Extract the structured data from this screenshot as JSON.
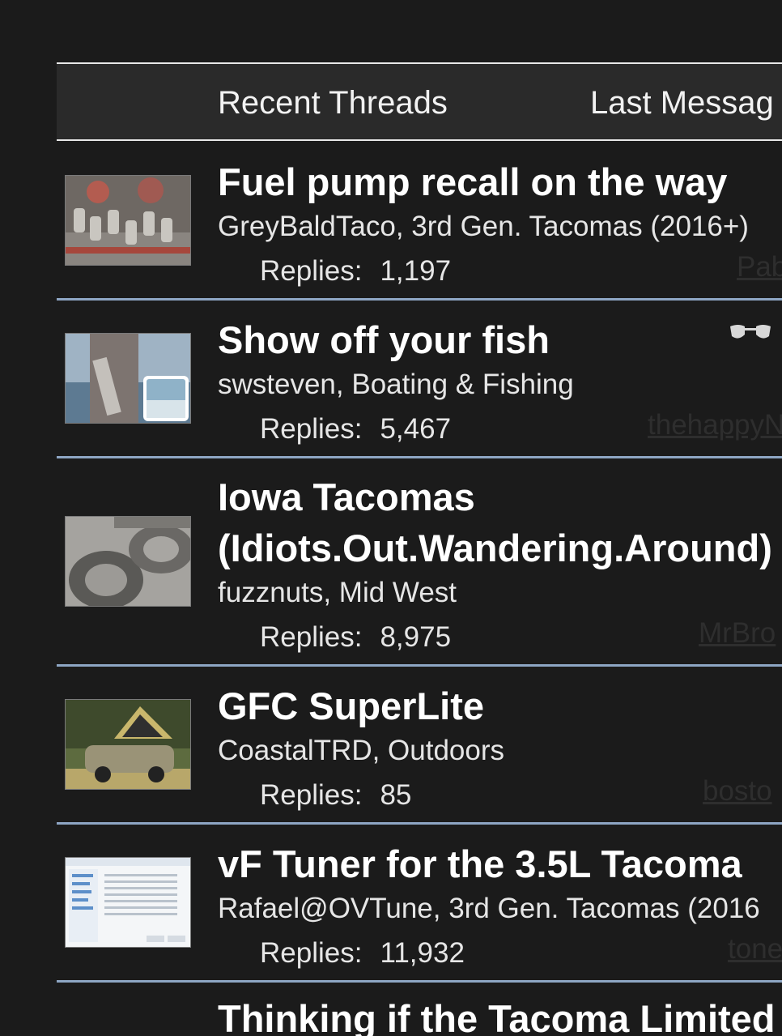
{
  "header": {
    "col_title": "Recent Threads",
    "col_last": "Last Messag"
  },
  "threads": [
    {
      "title": "Fuel pump recall on the way",
      "meta": "GreyBaldTaco, 3rd Gen. Tacomas (2016+)",
      "replies_label": "Replies:",
      "replies": "1,197",
      "last_user": "Pab"
    },
    {
      "title": "Show off your fish",
      "meta": "swsteven, Boating & Fishing",
      "replies_label": "Replies:",
      "replies": "5,467",
      "last_user": "thehappyN",
      "icon": "sunglasses-icon"
    },
    {
      "title_line1": "Iowa Tacomas",
      "title_line2": "(Idiots.Out.Wandering.Around)",
      "meta": "fuzznuts, Mid West",
      "replies_label": "Replies:",
      "replies": "8,975",
      "last_user": "MrBro"
    },
    {
      "title": "GFC SuperLite",
      "meta": "CoastalTRD, Outdoors",
      "replies_label": "Replies:",
      "replies": "85",
      "last_user": "bosto"
    },
    {
      "title": "vF Tuner for the 3.5L Tacoma",
      "meta": "Rafael@OVTune, 3rd Gen. Tacomas (2016",
      "replies_label": "Replies:",
      "replies": "11,932",
      "last_user": "tone"
    },
    {
      "title": "Thinking if the Tacoma Limited"
    }
  ],
  "colors": {
    "background": "#1b1b1b",
    "header_bg": "#2a2a2a",
    "divider": "#8ea6c4"
  }
}
